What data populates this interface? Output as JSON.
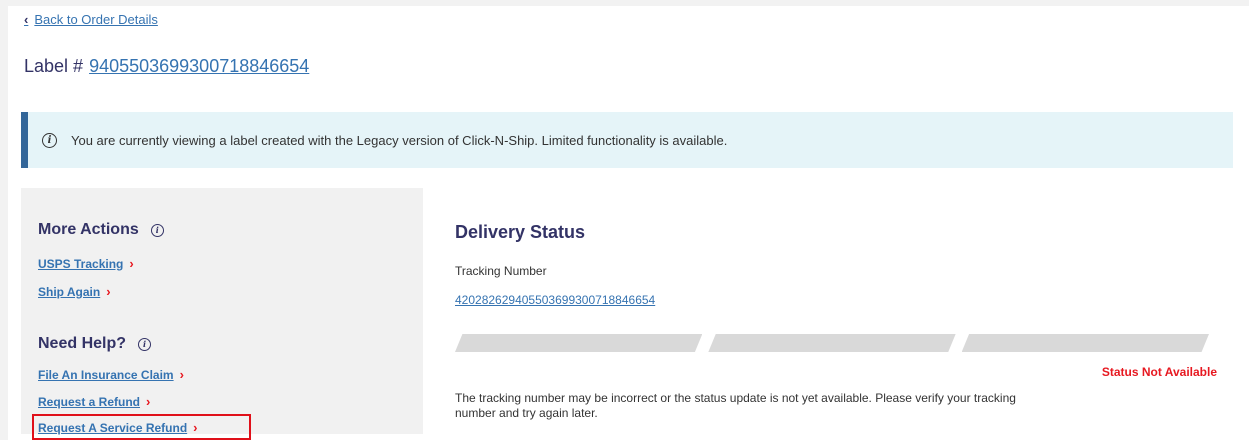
{
  "nav": {
    "back_label": "Back to Order Details"
  },
  "label": {
    "prefix": "Label #",
    "number": "9405503699300718846654"
  },
  "banner": {
    "text": "You are currently viewing a label created with the Legacy version of Click-N-Ship. Limited functionality is available."
  },
  "sidebar": {
    "more_actions": {
      "heading": "More Actions",
      "links": [
        {
          "label": "USPS Tracking"
        },
        {
          "label": "Ship Again"
        }
      ]
    },
    "need_help": {
      "heading": "Need Help?",
      "links": [
        {
          "label": "File An Insurance Claim"
        },
        {
          "label": "Request a Refund"
        },
        {
          "label": "Request A Service Refund"
        }
      ]
    }
  },
  "delivery": {
    "title": "Delivery Status",
    "tracking_label": "Tracking Number",
    "tracking_number": "420282629405503699300718846654",
    "status": "Status Not Available",
    "message": "The tracking number may be incorrect or the status update is not yet available. Please verify your tracking number and try again later.",
    "progress_steps_completed": 0
  },
  "colors": {
    "navy": "#333366",
    "link": "#3573b1",
    "red": "#e71921",
    "banner_bg": "#e5f4f8",
    "banner_border": "#336699"
  }
}
